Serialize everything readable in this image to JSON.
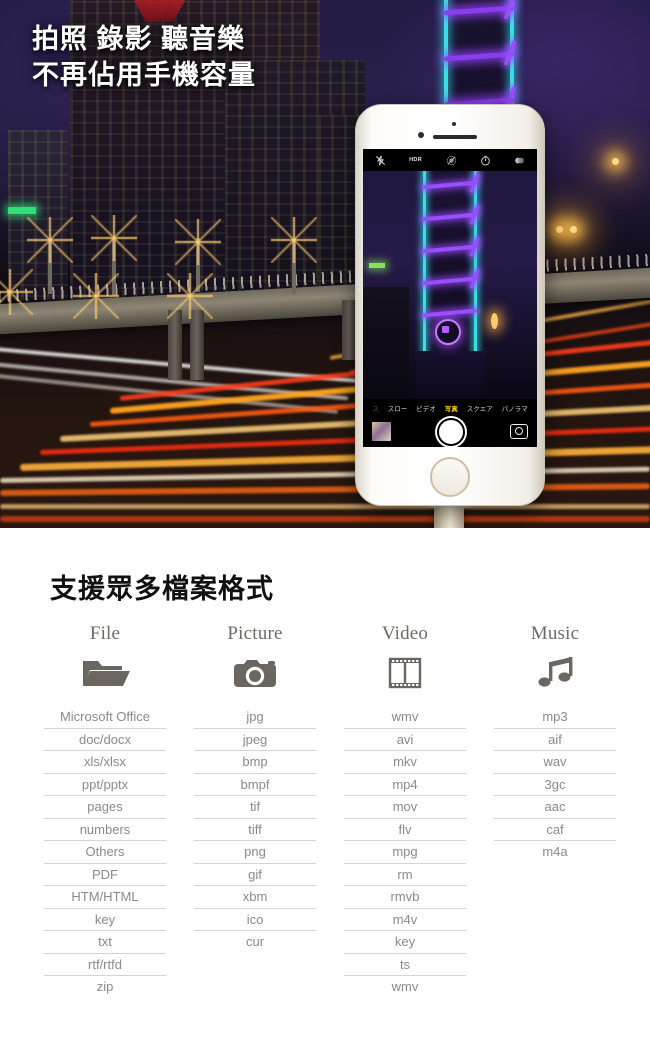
{
  "hero": {
    "headline_line1": "拍照 錄影 聽音樂",
    "headline_line2": "不再佔用手機容量",
    "headline": "拍照 錄影 聽音樂\n不再佔用手機容量"
  },
  "phone": {
    "camera_ui": {
      "top_bar_icons": [
        "flash-off-icon",
        "hdr-icon",
        "live-photo-icon",
        "timer-icon",
        "filters-icon"
      ],
      "hdr_label": "HDR",
      "modes": [
        {
          "label": "スロー",
          "selected": false,
          "dim": false
        },
        {
          "label": "ビデオ",
          "selected": false,
          "dim": false
        },
        {
          "label": "写真",
          "selected": true,
          "dim": false
        },
        {
          "label": "スクエア",
          "selected": false,
          "dim": false
        },
        {
          "label": "パノラマ",
          "selected": false,
          "dim": false
        }
      ],
      "bottom_icons": [
        "photo-thumbnail",
        "shutter-button",
        "camera-flip-icon"
      ],
      "selected_mode_color": "#ffcc00",
      "focus_indicator_color": "#b85cff"
    }
  },
  "formats": {
    "section_title": "支援眾多檔案格式",
    "columns": [
      {
        "title": "File",
        "icon": "folder-icon",
        "items": [
          "Microsoft Office",
          "doc/docx",
          "xls/xlsx",
          "ppt/pptx",
          "pages",
          "numbers",
          "Others",
          "PDF",
          "HTM/HTML",
          "key",
          "txt",
          "rtf/rtfd",
          "zip"
        ]
      },
      {
        "title": "Picture",
        "icon": "camera-icon",
        "items": [
          "jpg",
          "jpeg",
          "bmp",
          "bmpf",
          "tif",
          "tiff",
          "png",
          "gif",
          "xbm",
          "ico",
          "cur"
        ]
      },
      {
        "title": "Video",
        "icon": "film-strip-icon",
        "items": [
          "wmv",
          "avi",
          "mkv",
          "mp4",
          "mov",
          "flv",
          "mpg",
          "rm",
          "rmvb",
          "m4v",
          "key",
          "ts",
          "wmv"
        ]
      },
      {
        "title": "Music",
        "icon": "music-note-icon",
        "items": [
          "mp3",
          "aif",
          "wav",
          "3gc",
          "aac",
          "caf",
          "m4a"
        ]
      }
    ]
  },
  "colors": {
    "background": "#ffffff",
    "heading_text": "#111111",
    "hero_headline_text": "#ffffff",
    "column_title": "#6f6a64",
    "icon_gray": "#6b6660",
    "cell_text": "#8a8a88",
    "cell_rule": "#d4d4d2"
  }
}
